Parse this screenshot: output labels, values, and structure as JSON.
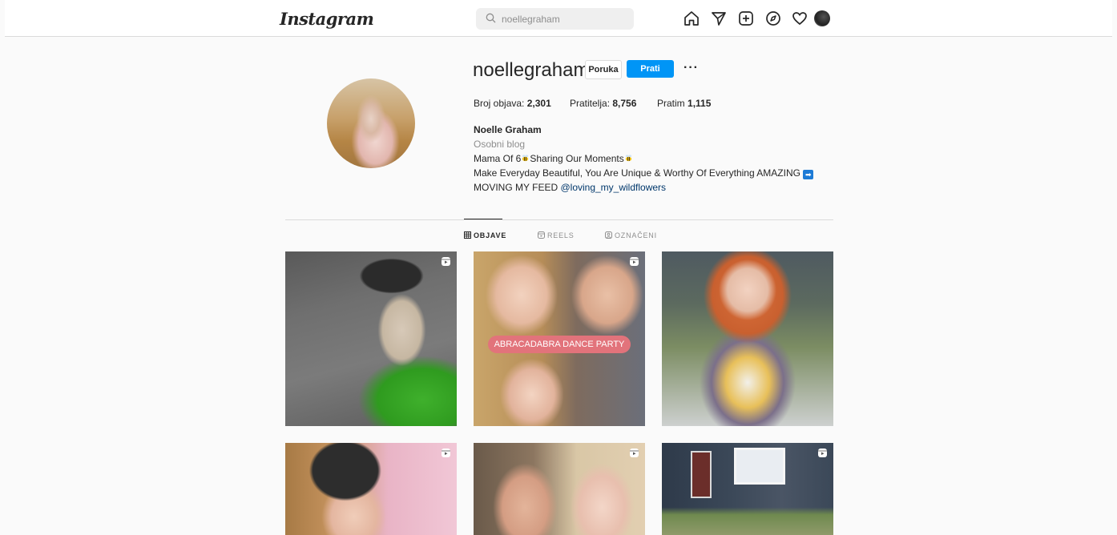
{
  "header": {
    "logo_text": "Instagram",
    "logo_chevron": "⌄",
    "search_placeholder": "noellegraham",
    "nav_icons": [
      "home-icon",
      "direct-icon",
      "new-post-icon",
      "explore-icon",
      "activity-icon",
      "profile-avatar"
    ]
  },
  "profile": {
    "username": "noellegraham",
    "message_button": "Poruka",
    "follow_button": "Prati",
    "more": "···",
    "stats": {
      "posts_label": "Broj objava:",
      "posts_value": "2,301",
      "followers_label": "Pratitelja:",
      "followers_value": "8,756",
      "following_label": "Pratim",
      "following_value": "1,115"
    },
    "full_name": "Noelle Graham",
    "category": "Osobni blog",
    "bio_line1_a": "Mama Of 6",
    "bio_line1_b": "Sharing Our Moments",
    "bio_line2": "Make Everyday Beautiful, You Are Unique & Worthy Of Everything AMAZING",
    "bio_line3_prefix": "MOVING MY FEED",
    "bio_line3_link": "@loving_my_wildflowers"
  },
  "tabs": [
    {
      "label": "OBJAVE",
      "active": true
    },
    {
      "label": "REELS",
      "active": false
    },
    {
      "label": "OZNAČENI",
      "active": false
    }
  ],
  "posts": {
    "p2_sticker": "ABRACADABRA DANCE PARTY"
  },
  "colors": {
    "accent": "#0095f6",
    "link": "#00376b",
    "sticker": "#e2737b"
  }
}
